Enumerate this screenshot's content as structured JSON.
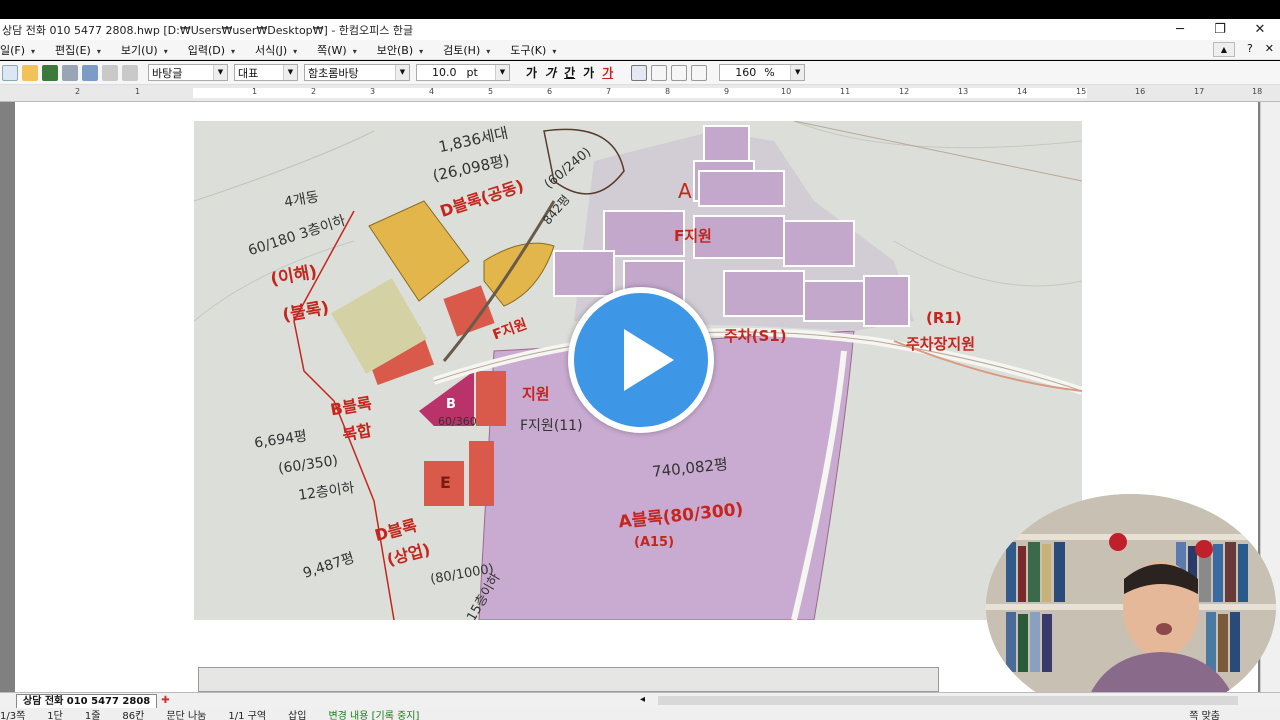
{
  "window": {
    "title": "상담 전화 010 5477 2808.hwp [D:₩Users₩user₩Desktop₩] - 한컴오피스 한글",
    "controls": {
      "minimize": "─",
      "restore": "❐",
      "close": "✕"
    }
  },
  "menubar": {
    "items": [
      {
        "label": "일(F)"
      },
      {
        "label": "편집(E)"
      },
      {
        "label": "보기(U)"
      },
      {
        "label": "입력(D)"
      },
      {
        "label": "서식(J)"
      },
      {
        "label": "쪽(W)"
      },
      {
        "label": "보안(B)"
      },
      {
        "label": "검토(H)"
      },
      {
        "label": "도구(K)"
      }
    ],
    "right_help": "?"
  },
  "toolbar": {
    "style_select": "바탕글",
    "lang_select": "대표",
    "font_select": "함초롬바탕",
    "size_value": "10.0",
    "size_unit": "pt",
    "bold": "가",
    "italic": "가",
    "underline": "간",
    "strike": "가",
    "color": "가",
    "zoom_value": "160",
    "zoom_unit": "%"
  },
  "ruler": {
    "ticks": [
      "2",
      "1",
      "1",
      "2",
      "3",
      "4",
      "5",
      "6",
      "7",
      "8",
      "9",
      "10",
      "11",
      "12",
      "13",
      "14",
      "15",
      "16",
      "17",
      "18"
    ]
  },
  "map": {
    "annotations": [
      "1,836세대",
      "(26,098평)",
      "4개동",
      "60/180 3층이하",
      "(이해)",
      "(블록)",
      "D블록(공동)",
      "(60/240)",
      "842평",
      "A",
      "F지원",
      "주차(S1)",
      "(R1)",
      "주차장지원",
      "B블록",
      "복합",
      "6,694평",
      "(60/350)",
      "12층이하",
      "F지원",
      "지원",
      "F지원(11)",
      "740,082평",
      "A블록(80/300)",
      "(A15)",
      "D블록",
      "(상업)",
      "9,487평",
      "(80/1000)",
      "15층이하",
      "E",
      "B",
      "60/360"
    ]
  },
  "tabs": {
    "doc_tab": "상담 전화 010 5477 2808"
  },
  "status": {
    "page": "1/3쪽",
    "section": "1단",
    "line": "1줄",
    "col": "86칸",
    "para": "문단 나눔",
    "area": "1/1 구역",
    "mode": "삽입",
    "track": "변경 내용 [기록 중지]",
    "fit": "쪽 맞춤"
  },
  "colors": {
    "play_button": "#3e96e6",
    "annotation_red": "#c4261e",
    "zone_purple": "#c8a8cf",
    "zone_yellow": "#e2b64a",
    "zone_red": "#d95a4a"
  }
}
